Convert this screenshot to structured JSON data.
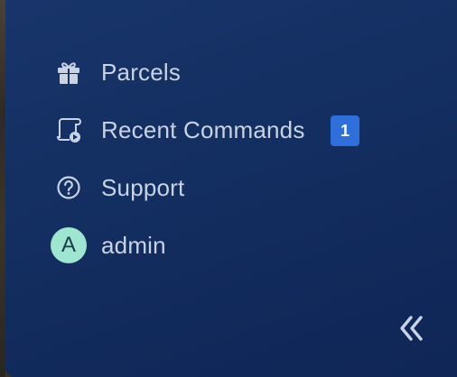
{
  "sidebar": {
    "items": [
      {
        "label": "Parcels",
        "icon": "gift-icon"
      },
      {
        "label": "Recent Commands",
        "icon": "scroll-play-icon",
        "badge": "1"
      },
      {
        "label": "Support",
        "icon": "help-circle-icon"
      }
    ],
    "user": {
      "avatar_initial": "A",
      "name": "admin"
    },
    "collapse_icon": "double-chevron-left-icon",
    "colors": {
      "background": "#132e60",
      "text": "#c9d3e4",
      "badge": "#2f6fdc",
      "avatar": "#9ee6cf"
    }
  }
}
